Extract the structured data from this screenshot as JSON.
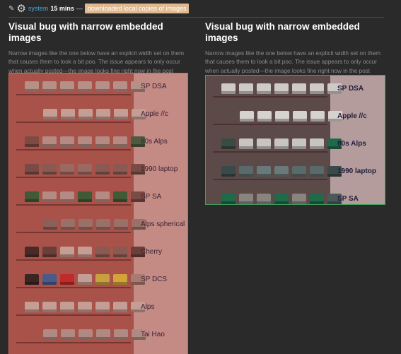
{
  "topbar": {
    "user": "system",
    "time": "15 mins",
    "dash": "—",
    "tag": "downloaded local copies of images"
  },
  "icons": {
    "edit": "pencil-icon",
    "avatar": "gear-icon"
  },
  "posts": [
    {
      "title": "Visual bug with narrow embedded images",
      "description": "Narrow images like the one below have an explicit width set on them that causes them to look a bit poo. The issue appears to only occur when actually posted—the image looks fine right now in the post preview."
    },
    {
      "title": "Visual bug with narrow embedded images",
      "description": "Narrow images like the one below have an explicit width set on them that causes them to look a bit poo. The issue appears to only occur when actually posted—the image looks fine right now in the post preview."
    }
  ],
  "keycap_rows_left": [
    "SP DSA",
    "Apple //c",
    "80s Alps",
    "1990 laptop",
    "SP SA",
    "Alps spherical",
    "Cherry",
    "SP DCS",
    "Alps",
    "Tai Hao"
  ],
  "keycap_rows_right": [
    "SP DSA",
    "Apple //c",
    "80s Alps",
    "1990 laptop",
    "SP SA"
  ],
  "colors": {
    "left_frame_border": "#d0665c",
    "right_frame_border": "#3fa05a",
    "tag_background": "#e0b98f",
    "link": "#4aa3df"
  }
}
